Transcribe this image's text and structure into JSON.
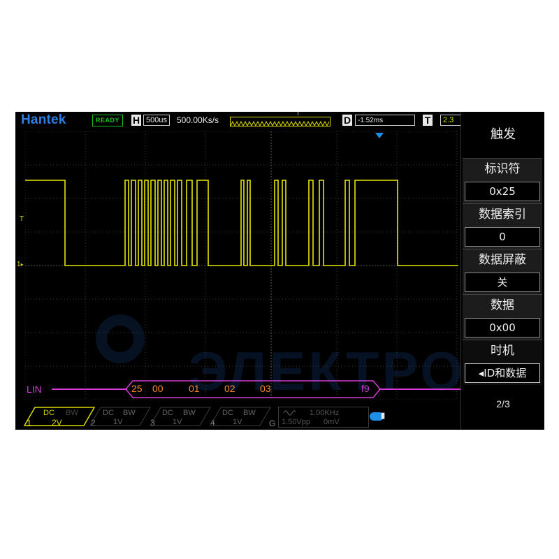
{
  "brand": "Hantek",
  "status": "READY",
  "timebase": {
    "letter": "H",
    "value": "500us",
    "sample_rate": "500.00Ks/s"
  },
  "delay": {
    "letter": "D",
    "value": "-1.52ms"
  },
  "trigger_level": {
    "letter": "T",
    "value": "2.3"
  },
  "watermark": "ЭЛЕКТРОНИКС",
  "channel_marks": {
    "trigger": "T",
    "ch1": "1"
  },
  "bus": {
    "label": "LIN",
    "bytes": [
      "25",
      "00",
      "01",
      "02",
      "03",
      "f9"
    ]
  },
  "channels": [
    {
      "num": "1",
      "coupling": "DC",
      "bw": "BW",
      "scale": "2V",
      "active": true
    },
    {
      "num": "2",
      "coupling": "DC",
      "bw": "BW",
      "scale": "1V",
      "active": false
    },
    {
      "num": "3",
      "coupling": "DC",
      "bw": "BW",
      "scale": "1V",
      "active": false
    },
    {
      "num": "4",
      "coupling": "DC",
      "bw": "BW",
      "scale": "1V",
      "active": false
    }
  ],
  "generator": {
    "letter": "G",
    "freq": "1.00KHz",
    "amp": "1.50Vpp",
    "offset": "0mV",
    "wave_icon": "sine-wave-icon"
  },
  "usb_icon": "usb-icon",
  "menu": {
    "title": "触发",
    "items": [
      {
        "label": "标识符",
        "value": "0x25"
      },
      {
        "label": "数据索引",
        "value": "0"
      },
      {
        "label": "数据屏蔽",
        "value": "关"
      },
      {
        "label": "数据",
        "value": "0x00"
      },
      {
        "label": "时机",
        "value": "◂ID和数据"
      }
    ],
    "page": "2/3"
  },
  "colors": {
    "ch1": "#d9d900",
    "bus": "#d63ad6",
    "bus_bytes": "#ff8a2a",
    "accent": "#1e8fe6",
    "ready": "#19c219"
  }
}
